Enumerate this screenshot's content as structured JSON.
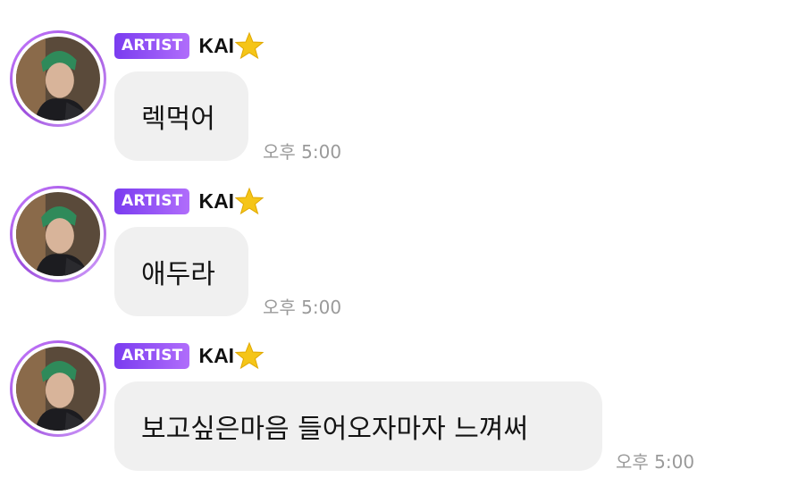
{
  "messages": [
    {
      "badge": "ARTIST",
      "sender": "KAI",
      "text": "렉먹어",
      "time": "오후 5:00"
    },
    {
      "badge": "ARTIST",
      "sender": "KAI",
      "text": "애두라",
      "time": "오후 5:00"
    },
    {
      "badge": "ARTIST",
      "sender": "KAI",
      "text": "보고싶은마음 들어오자마자 느껴써",
      "time": "오후 5:00"
    }
  ],
  "colors": {
    "badge_gradient_start": "#7a3cf0",
    "badge_gradient_end": "#b06dfb",
    "bubble_bg": "#f0f0f0",
    "time_text": "#9a9a9a",
    "avatar_ring": "#9d4edd"
  },
  "icons": {
    "sender_star": "star-icon"
  }
}
